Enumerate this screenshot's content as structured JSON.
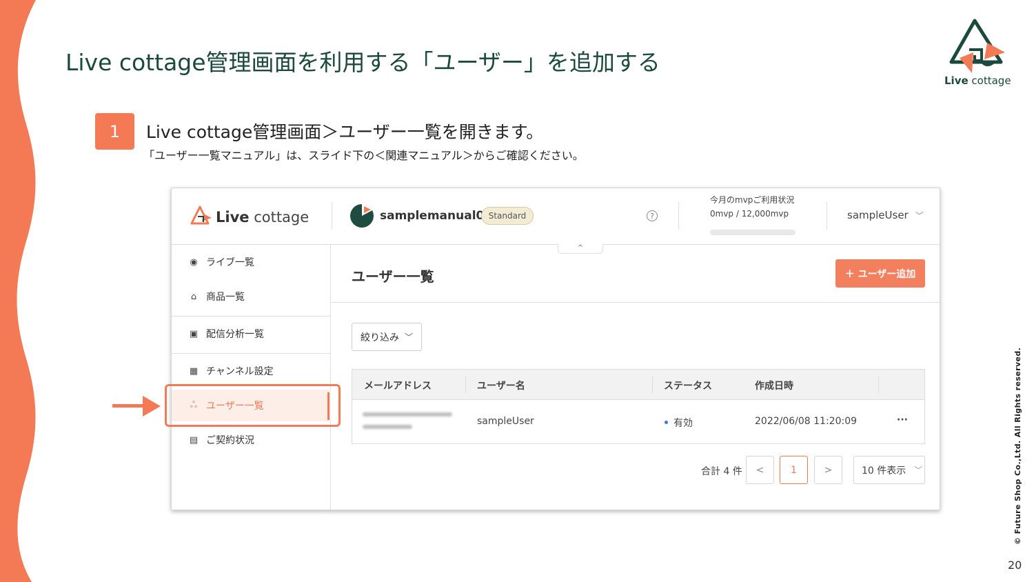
{
  "slide": {
    "title": "Live cottage管理画面を利用する「ユーザー」を追加する",
    "brand_bold": "Live",
    "brand_rest": " cottage",
    "step_number": "1",
    "step_title": "Live cottage管理画面＞ユーザー一覧を開きます。",
    "step_note": "「ユーザー一覧マニュアル」は、スライド下の＜関連マニュアル＞からご確認ください。",
    "copyright": "© Future Shop Co.,Ltd. All Rights reserved.",
    "page_number": "20"
  },
  "app": {
    "logo_bold": "Live",
    "logo_rest": " cottage",
    "channel_name": "samplemanual01",
    "plan": "Standard",
    "help": "?",
    "usage_label": "今月のmvpご利用状況",
    "usage_value": "0mvp / 12,000mvp",
    "usage_fraction": 0,
    "user_name": "sampleUser",
    "collapse": "^"
  },
  "sidebar": {
    "items": [
      {
        "label": "ライブ一覧",
        "icon": "play-circle-icon"
      },
      {
        "label": "商品一覧",
        "icon": "bag-icon"
      },
      {
        "label": "配信分析一覧",
        "icon": "chart-icon"
      },
      {
        "label": "チャンネル設定",
        "icon": "building-icon"
      },
      {
        "label": "ユーザー一覧",
        "icon": "users-icon",
        "active": true
      },
      {
        "label": "ご契約状況",
        "icon": "document-icon"
      }
    ]
  },
  "main": {
    "title": "ユーザー一覧",
    "add_button": "＋ ユーザー追加",
    "filter_button": "絞り込み",
    "table": {
      "headers": [
        "メールアドレス",
        "ユーザー名",
        "ステータス",
        "作成日時"
      ],
      "rows": [
        {
          "username": "sampleUser",
          "status": "有効",
          "created": "2022/06/08 11:20:09",
          "menu": "···"
        }
      ]
    },
    "pagination": {
      "total": "合計 4 件",
      "prev": "<",
      "current": "1",
      "next": ">",
      "page_size": "10 件表示"
    }
  },
  "colors": {
    "accent": "#f47a56",
    "brand_green": "#1b4a3c",
    "status_blue": "#3b7bd5"
  }
}
